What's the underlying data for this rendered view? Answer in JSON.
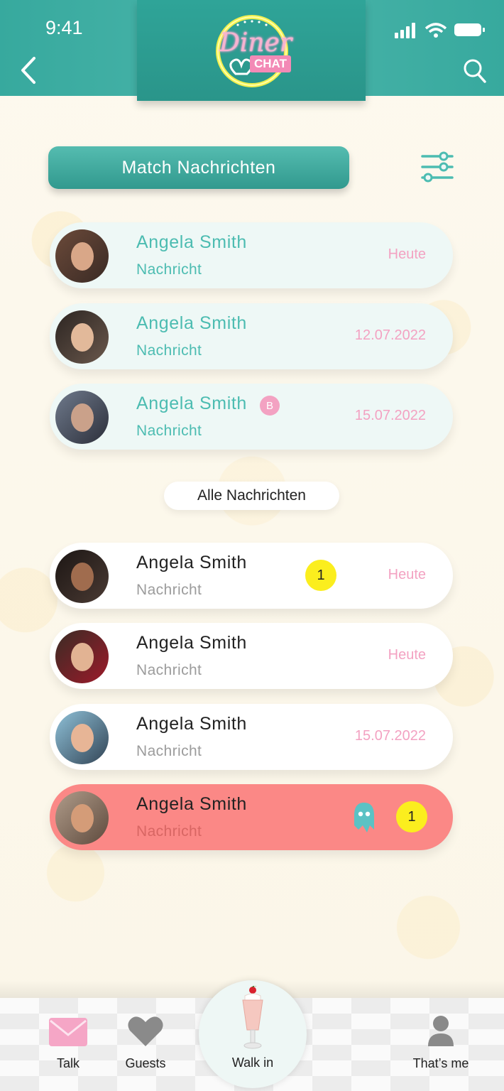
{
  "status_bar": {
    "time": "9:41"
  },
  "header": {
    "logo_word": "Diner",
    "logo_badge": "CHAT"
  },
  "section": {
    "match_title": "Match Nachrichten",
    "all_title": "Alle Nachrichten"
  },
  "match_messages": [
    {
      "name": "Angela Smith",
      "preview": "Nachricht",
      "date": "Heute"
    },
    {
      "name": "Angela Smith",
      "preview": "Nachricht",
      "date": "12.07.2022"
    },
    {
      "name": "Angela Smith",
      "preview": "Nachricht",
      "date": "15.07.2022",
      "badge": "B"
    }
  ],
  "all_messages": [
    {
      "name": "Angela Smith",
      "preview": "Nachricht",
      "date": "Heute",
      "unread": "1"
    },
    {
      "name": "Angela Smith",
      "preview": "Nachricht",
      "date": "Heute"
    },
    {
      "name": "Angela Smith",
      "preview": "Nachricht",
      "date": "15.07.2022"
    },
    {
      "name": "Angela Smith",
      "preview": "Nachricht",
      "unread": "1"
    }
  ],
  "bottom_nav": {
    "talk": "Talk",
    "guests": "Guests",
    "walk_in": "Walk in",
    "thats_me": "That’s me"
  },
  "colors": {
    "teal": "#37a99e",
    "pink": "#f3a2c2",
    "alert": "#fb8886",
    "badge_yellow": "#fbee1e"
  },
  "icons": [
    "back-arrow-icon",
    "search-icon",
    "filter-sliders-icon",
    "ghost-icon",
    "mail-icon",
    "heart-icon",
    "milkshake-icon",
    "person-icon"
  ]
}
